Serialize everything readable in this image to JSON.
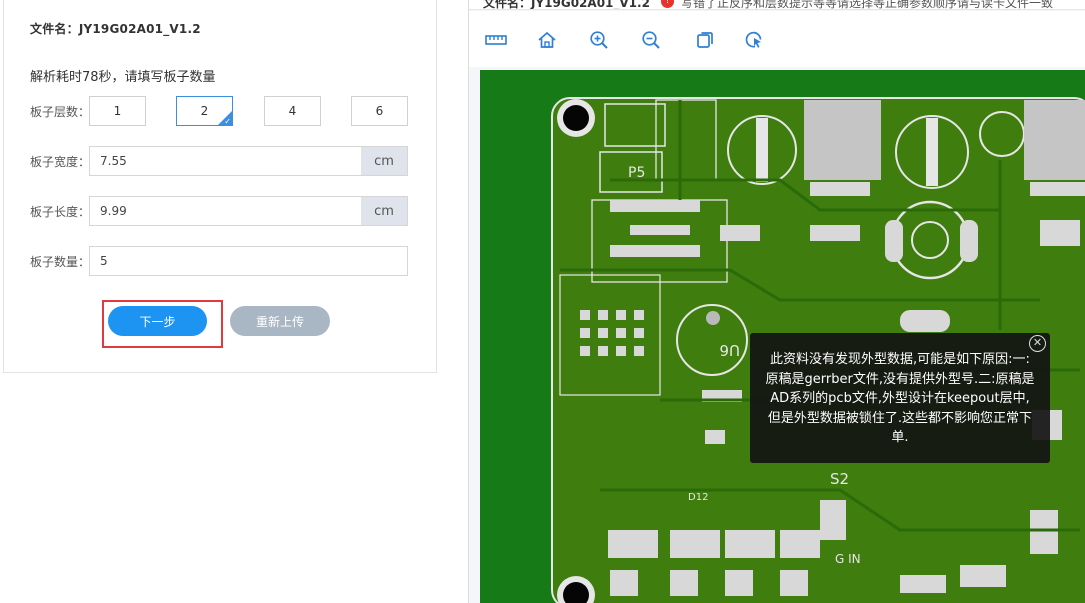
{
  "file": {
    "label": "文件名：",
    "name": "JY19G02A01_V1.2"
  },
  "parse_info": "解析耗时78秒，请填写板子数量",
  "layers": {
    "label": "板子层数：",
    "options": [
      "1",
      "2",
      "4",
      "6"
    ],
    "selected": "2"
  },
  "width": {
    "label": "板子宽度：",
    "value": "7.55",
    "unit": "cm"
  },
  "length": {
    "label": "板子长度：",
    "value": "9.99",
    "unit": "cm"
  },
  "quantity": {
    "label": "板子数量：",
    "value": "5"
  },
  "buttons": {
    "next": "下一步",
    "reupload": "重新上传"
  },
  "viewer": {
    "title_partial": "文件名：JY19G02A01_V1.2",
    "notice_partial": "写错了正反序和层数提示等等请选择等正确参数顺序请与读卡文件一致",
    "tools": [
      "fit-width-icon",
      "home-icon",
      "zoom-in-icon",
      "zoom-out-icon",
      "copy-icon",
      "rotate-cursor-icon"
    ],
    "pcb_labels": {
      "p5": "P5",
      "s2": "S2",
      "gin": "G IN",
      "d12": "D12",
      "u6": "U6"
    },
    "tooltip": "此资料没有发现外型数据,可能是如下原因:一:原稿是gerrber文件,没有提供外型号.二:原稿是AD系列的pcb文件,外型设计在keepout层中,但是外型数据被锁住了.这些都不影响您正常下单."
  },
  "colors": {
    "accent": "#1e94f2",
    "pcb_green": "#167a16",
    "highlight": "#e0393e"
  }
}
